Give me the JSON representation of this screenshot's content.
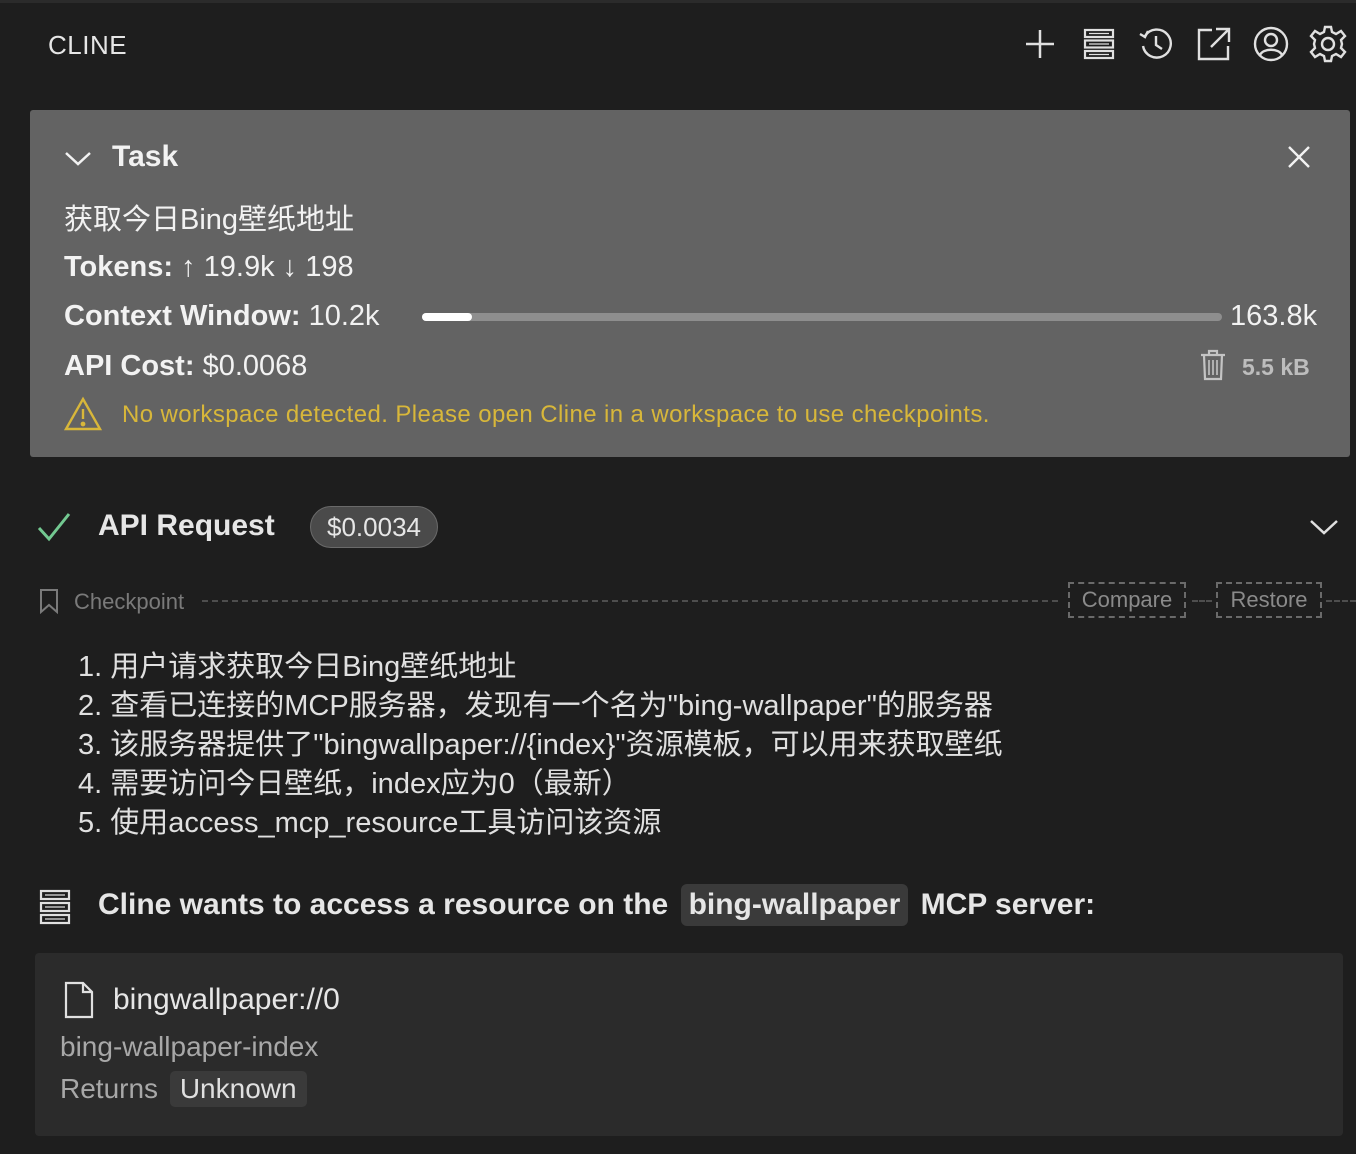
{
  "header": {
    "title": "CLINE",
    "icons": [
      "plus-icon",
      "server-icon",
      "history-icon",
      "popout-icon",
      "account-icon",
      "gear-icon"
    ]
  },
  "task": {
    "label": "Task",
    "text": "获取今日Bing壁纸地址",
    "tokens_label": "Tokens:",
    "tokens_up": "↑ 19.9k",
    "tokens_down": "↓ 198",
    "context_label": "Context Window:",
    "context_used": "10.2k",
    "context_max": "163.8k",
    "context_fraction": 0.0623,
    "cost_label": "API Cost:",
    "cost_value": "$0.0068",
    "size": "5.5 kB",
    "warning": "No workspace detected. Please open Cline in a workspace to use checkpoints."
  },
  "api_request": {
    "title": "API Request",
    "cost": "$0.0034"
  },
  "checkpoint": {
    "label": "Checkpoint",
    "compare": "Compare",
    "restore": "Restore"
  },
  "steps": [
    "1. 用户请求获取今日Bing壁纸地址",
    "2. 查看已连接的MCP服务器，发现有一个名为\"bing-wallpaper\"的服务器",
    "3. 该服务器提供了\"bingwallpaper://{index}\"资源模板，可以用来获取壁纸",
    "4. 需要访问今日壁纸，index应为0（最新）",
    "5. 使用access_mcp_resource工具访问该资源"
  ],
  "mcp": {
    "prefix": "Cline wants to access a resource on the",
    "server": "bing-wallpaper",
    "suffix": "MCP server:"
  },
  "resource": {
    "uri": "bingwallpaper://0",
    "name": "bing-wallpaper-index",
    "returns_label": "Returns",
    "returns_value": "Unknown"
  },
  "colors": {
    "background": "#1e1e1e",
    "task_panel": "#636363",
    "warning": "#d8b73a",
    "success": "#73c991"
  }
}
